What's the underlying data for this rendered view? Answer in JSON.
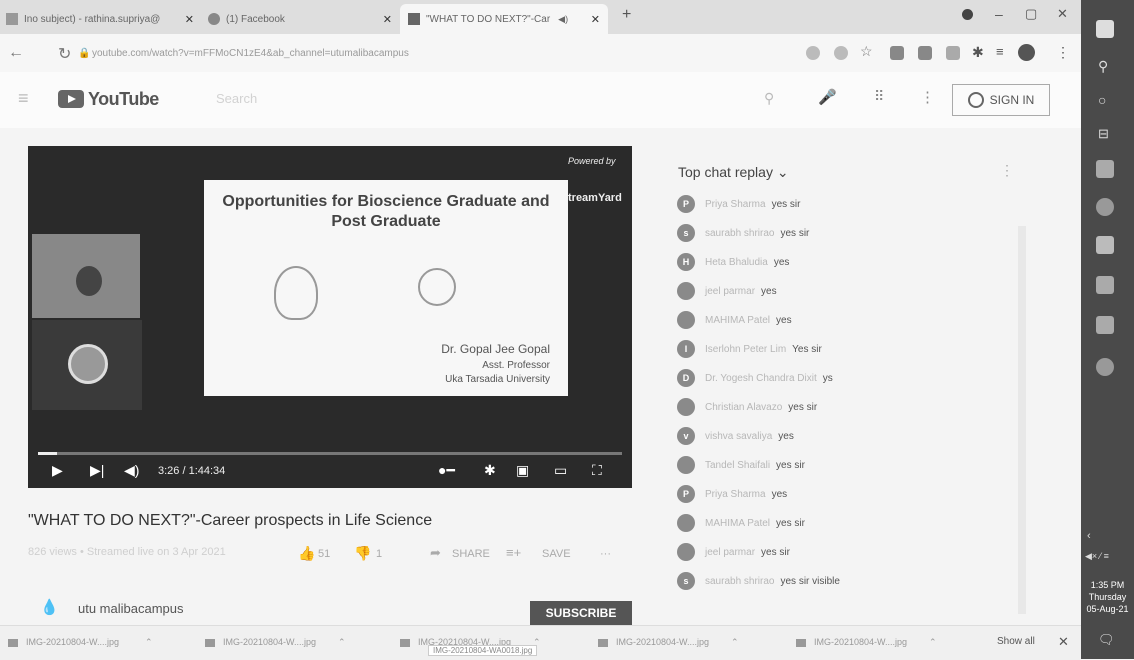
{
  "browser": {
    "tabs": [
      {
        "label": "Ino subject) - rathina.supriya@",
        "close": "✕"
      },
      {
        "label": "(1) Facebook",
        "close": "✕"
      },
      {
        "label": "\"WHAT TO DO NEXT?\"-Car",
        "close": "✕"
      }
    ],
    "new_tab": "+",
    "url": "youtube.com/watch?v=mFFMoCN1zE4&ab_channel=utumalibacampus",
    "window_controls": {
      "minimize": "–",
      "maximize": "▢",
      "close": "✕"
    }
  },
  "youtube": {
    "logo_text": "YouTube",
    "search_placeholder": "Search",
    "sign_in": "SIGN IN"
  },
  "video": {
    "slide_title": "Opportunities for Bioscience Graduate and Post Graduate",
    "presenter_name": "Dr. Gopal Jee Gopal",
    "presenter_role": "Asst. Professor",
    "presenter_org": "Uka Tarsadia University",
    "powered_by": "Powered by",
    "streamyard": "treamYard",
    "time": "3:26 / 1:44:34",
    "progress_fraction": 0.033
  },
  "meta": {
    "title": "\"WHAT TO DO NEXT?\"-Career prospects in Life Science",
    "views": "826 views • Streamed live on 3 Apr 2021",
    "likes": "51",
    "dislikes": "1",
    "share": "SHARE",
    "save": "SAVE",
    "more": "···"
  },
  "channel": {
    "name": "utu malibacampus",
    "subscribe": "SUBSCRIBE"
  },
  "chat": {
    "header": "Top chat replay",
    "menu": "⋮",
    "messages": [
      {
        "initial": "P",
        "name": "Priya Sharma",
        "text": "yes sir"
      },
      {
        "initial": "s",
        "name": "saurabh shrirao",
        "text": "yes sir"
      },
      {
        "initial": "H",
        "name": "Heta Bhaludia",
        "text": "yes"
      },
      {
        "initial": "",
        "name": "jeel parmar",
        "text": "yes"
      },
      {
        "initial": "",
        "name": "MAHIMA Patel",
        "text": "yes"
      },
      {
        "initial": "I",
        "name": "Iserlohn Peter Lim",
        "text": "Yes sir"
      },
      {
        "initial": "D",
        "name": "Dr. Yogesh Chandra Dixit",
        "text": "ys"
      },
      {
        "initial": "",
        "name": "Christian Alavazo",
        "text": "yes sir"
      },
      {
        "initial": "v",
        "name": "vishva savaliya",
        "text": "yes"
      },
      {
        "initial": "",
        "name": "Tandel Shaifali",
        "text": "yes sir"
      },
      {
        "initial": "P",
        "name": "Priya Sharma",
        "text": "yes"
      },
      {
        "initial": "",
        "name": "MAHIMA Patel",
        "text": "yes sir"
      },
      {
        "initial": "",
        "name": "jeel parmar",
        "text": "yes sir"
      },
      {
        "initial": "s",
        "name": "saurabh shrirao",
        "text": "yes sir visible"
      }
    ]
  },
  "downloads": {
    "items": [
      "IMG-20210804-W....jpg",
      "IMG-20210804-W....jpg",
      "IMG-20210804-W....jpg",
      "IMG-20210804-W....jpg",
      "IMG-20210804-W....jpg"
    ],
    "tooltip": "IMG-20210804-WA0018.jpg",
    "show_all": "Show all",
    "close": "✕"
  },
  "taskbar": {
    "time": "1:35 PM",
    "day": "Thursday",
    "date": "05-Aug-21"
  }
}
